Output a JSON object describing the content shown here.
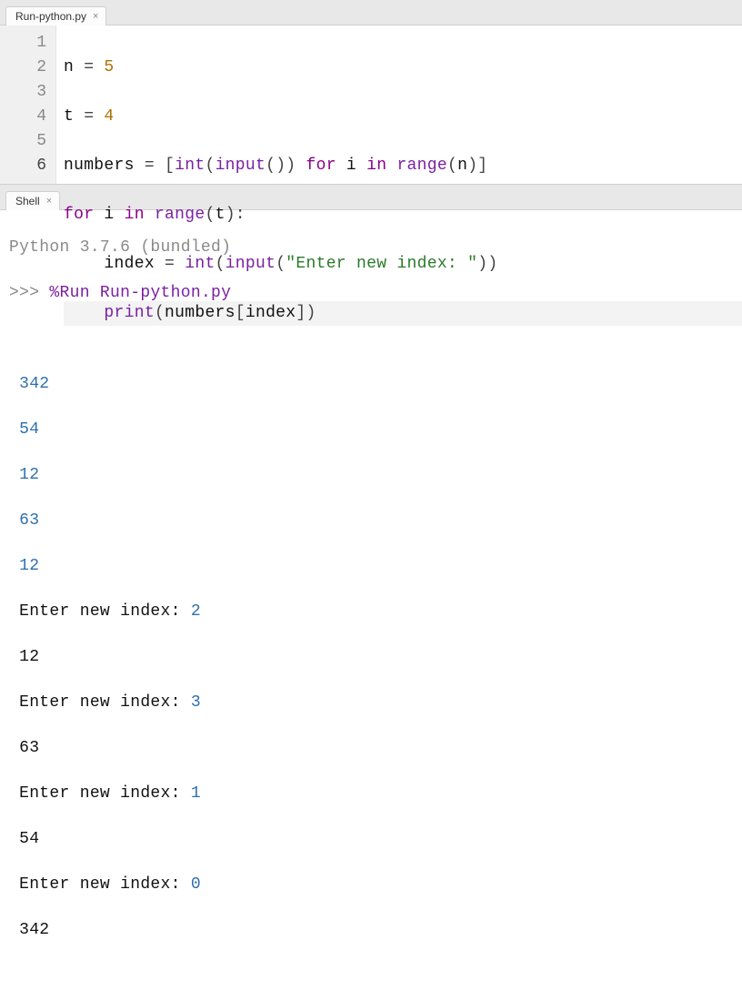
{
  "editor_tab": {
    "label": "Run-python.py",
    "close": "×"
  },
  "line_numbers": [
    "1",
    "2",
    "3",
    "4",
    "5",
    "6"
  ],
  "current_line_index": 5,
  "code": {
    "l1_n": "n",
    "l1_eq": " = ",
    "l1_5": "5",
    "l2_t": "t",
    "l2_eq": " = ",
    "l2_4": "4",
    "l3_numbers": "numbers",
    "l3_eq": " = ",
    "l3_lbr": "[",
    "l3_int": "int",
    "l3_lp1": "(",
    "l3_input": "input",
    "l3_lp2": "(",
    "l3_rp2": ")",
    "l3_rp1": ")",
    "l3_for": " for ",
    "l3_i": "i",
    "l3_in": " in ",
    "l3_range": "range",
    "l3_lp3": "(",
    "l3_nvar": "n",
    "l3_rp3": ")",
    "l3_rbr": "]",
    "l4_for": "for ",
    "l4_i": "i",
    "l4_in": " in ",
    "l4_range": "range",
    "l4_lp": "(",
    "l4_t": "t",
    "l4_rp": ")",
    "l4_colon": ":",
    "l5_indent": "    ",
    "l5_index": "index",
    "l5_eq": " = ",
    "l5_int": "int",
    "l5_lp1": "(",
    "l5_input": "input",
    "l5_lp2": "(",
    "l5_str": "\"Enter new index: \"",
    "l5_rp2": ")",
    "l5_rp1": ")",
    "l6_indent": "    ",
    "l6_print": "print",
    "l6_lp": "(",
    "l6_numbers": "numbers",
    "l6_lbr": "[",
    "l6_index": "index",
    "l6_rbr": "]",
    "l6_rp": ")"
  },
  "shell_tab": {
    "label": "Shell",
    "close": "×"
  },
  "shell": {
    "banner": "Python 3.7.6 (bundled)",
    "prompt": ">>> ",
    "run": "%Run Run-python.py",
    "blank": " ",
    "in1": " 342",
    "in2": " 54",
    "in3": " 12",
    "in4": " 63",
    "in5": " 12",
    "p1_label": " Enter new index: ",
    "p1_val": "2",
    "p1_out": " 12",
    "p2_label": " Enter new index: ",
    "p2_val": "3",
    "p2_out": " 63",
    "p3_label": " Enter new index: ",
    "p3_val": "1",
    "p3_out": " 54",
    "p4_label": " Enter new index: ",
    "p4_val": "0",
    "p4_out": " 342"
  }
}
